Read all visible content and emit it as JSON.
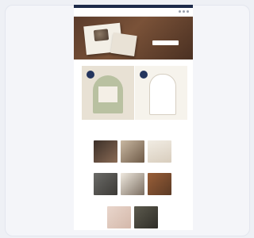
{
  "store": {
    "logo_text": "",
    "announcement": "",
    "nav_left": ""
  },
  "hero": {
    "headline": "",
    "cta_label": ""
  },
  "section": {
    "title": ""
  },
  "products": [
    {
      "caption": ""
    },
    {
      "caption": ""
    },
    {
      "caption": ""
    },
    {
      "caption": ""
    },
    {
      "caption": ""
    },
    {
      "caption": ""
    },
    {
      "caption": ""
    },
    {
      "caption": ""
    }
  ],
  "colors": {
    "accent_navy": "#1d2a4a",
    "hero_brown": "#5a3b2b",
    "badge_navy": "#24355e",
    "sage": "#b9c1a1"
  }
}
